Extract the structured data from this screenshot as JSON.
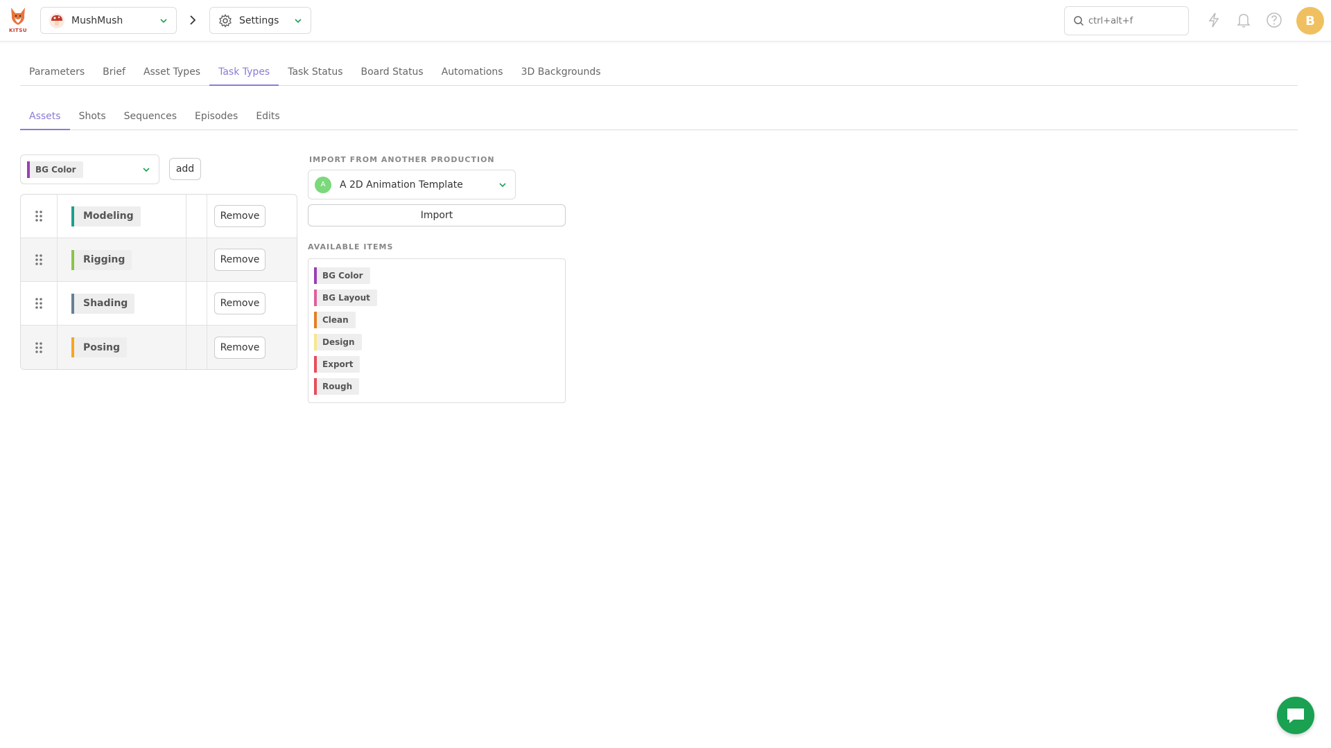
{
  "header": {
    "logo_text": "KITSU",
    "production": {
      "name": "MushMush"
    },
    "section": {
      "name": "Settings"
    },
    "search": {
      "placeholder": "ctrl+alt+f"
    },
    "user_initial": "B"
  },
  "main_tabs": [
    {
      "label": "Parameters",
      "active": false
    },
    {
      "label": "Brief",
      "active": false
    },
    {
      "label": "Asset Types",
      "active": false
    },
    {
      "label": "Task Types",
      "active": true
    },
    {
      "label": "Task Status",
      "active": false
    },
    {
      "label": "Board Status",
      "active": false
    },
    {
      "label": "Automations",
      "active": false
    },
    {
      "label": "3D Backgrounds",
      "active": false
    }
  ],
  "sub_tabs": [
    {
      "label": "Assets",
      "active": true
    },
    {
      "label": "Shots",
      "active": false
    },
    {
      "label": "Sequences",
      "active": false
    },
    {
      "label": "Episodes",
      "active": false
    },
    {
      "label": "Edits",
      "active": false
    }
  ],
  "task_type_picker": {
    "selected": {
      "label": "BG Color",
      "color": "#9b3fb5"
    },
    "add_label": "add"
  },
  "task_types": [
    {
      "name": "Modeling",
      "color": "#1e9e8f",
      "remove_label": "Remove"
    },
    {
      "name": "Rigging",
      "color": "#8bc34a",
      "remove_label": "Remove"
    },
    {
      "name": "Shading",
      "color": "#667f94",
      "remove_label": "Remove"
    },
    {
      "name": "Posing",
      "color": "#f5a623",
      "remove_label": "Remove"
    }
  ],
  "import_panel": {
    "heading": "IMPORT FROM ANOTHER PRODUCTION",
    "production": {
      "initial": "A",
      "name": "A 2D Animation Template"
    },
    "import_label": "Import",
    "available_heading": "AVAILABLE ITEMS",
    "available_items": [
      {
        "name": "BG Color",
        "color": "#9b3fb5"
      },
      {
        "name": "BG Layout",
        "color": "#e0609b"
      },
      {
        "name": "Clean",
        "color": "#e67e22"
      },
      {
        "name": "Design",
        "color": "#f5e88a"
      },
      {
        "name": "Export",
        "color": "#e84c5a"
      },
      {
        "name": "Rough",
        "color": "#e84c5a"
      }
    ]
  }
}
